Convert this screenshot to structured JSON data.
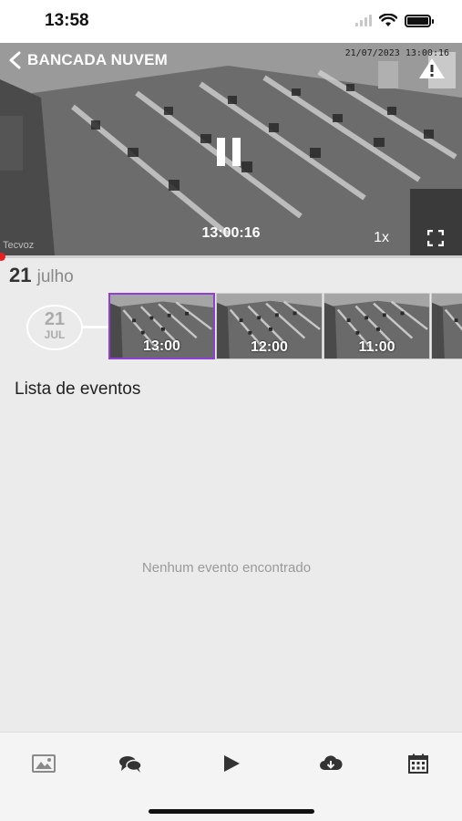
{
  "status": {
    "time": "13:58"
  },
  "player": {
    "title": "BANCADA NUVEM",
    "camera_timestamp": "21/07/2023 13:00:16",
    "watermark": "Tecvoz",
    "current_time": "13:00:16",
    "speed": "1x",
    "progress": 0
  },
  "date": {
    "day": "21",
    "month": "julho",
    "circle_day": "21",
    "circle_month": "JUL"
  },
  "thumbnails": [
    {
      "label": "13:00",
      "selected": true
    },
    {
      "label": "12:00",
      "selected": false
    },
    {
      "label": "11:00",
      "selected": false
    },
    {
      "label": "",
      "selected": false
    }
  ],
  "events": {
    "title": "Lista de eventos",
    "empty_message": "Nenhum evento encontrado"
  },
  "tabbar": {
    "items": [
      "image-icon",
      "chat-icon",
      "play-icon",
      "cloud-download-icon",
      "calendar-icon"
    ]
  },
  "colors": {
    "accent": "#8e3fd6",
    "progress": "#e62020"
  }
}
